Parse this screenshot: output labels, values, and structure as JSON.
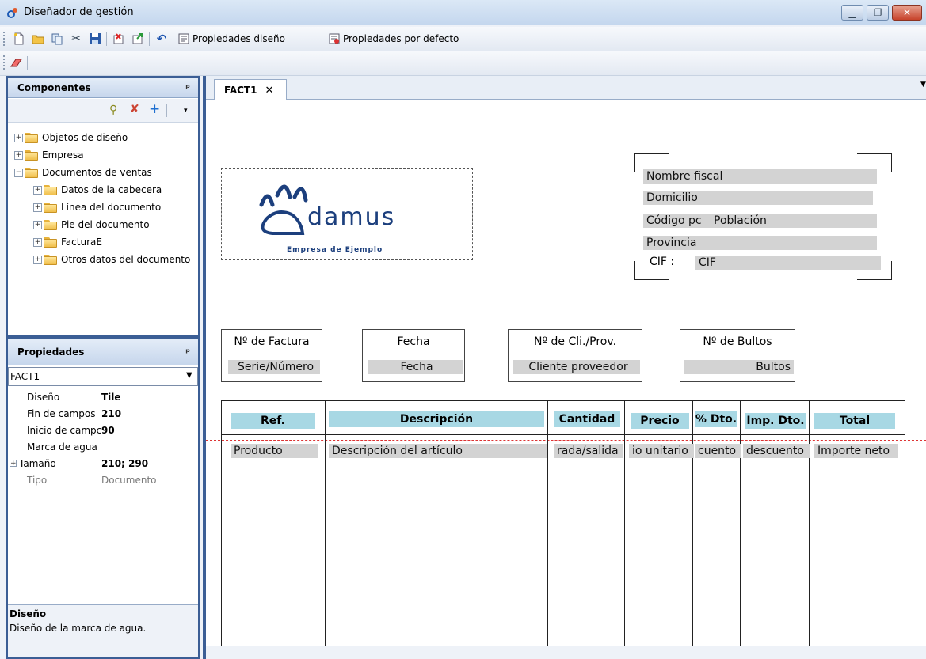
{
  "window": {
    "title": "Diseñador de gestión"
  },
  "toolbar": {
    "design_props": "Propiedades diseño",
    "default_props": "Propiedades por defecto"
  },
  "components": {
    "title": "Componentes",
    "tree": [
      {
        "label": "Objetos de diseño",
        "level": 0,
        "expander": "+"
      },
      {
        "label": "Empresa",
        "level": 0,
        "expander": "+"
      },
      {
        "label": "Documentos de ventas",
        "level": 0,
        "expander": "−"
      },
      {
        "label": "Datos de la cabecera",
        "level": 1,
        "expander": "+"
      },
      {
        "label": "Línea del documento",
        "level": 1,
        "expander": "+"
      },
      {
        "label": "Pie del documento",
        "level": 1,
        "expander": "+"
      },
      {
        "label": "FacturaE",
        "level": 1,
        "expander": "+"
      },
      {
        "label": "Otros datos del documento",
        "level": 1,
        "expander": "+"
      }
    ]
  },
  "properties": {
    "title": "Propiedades",
    "selected": "FACT1",
    "rows": [
      {
        "key": "Diseño",
        "value": "Tile"
      },
      {
        "key": "Fin de campos",
        "value": "210"
      },
      {
        "key": "Inicio de campc",
        "value": "90"
      },
      {
        "key": "Marca de agua",
        "value": ""
      },
      {
        "key": "Tamaño",
        "value": "210; 290"
      },
      {
        "key": "Tipo",
        "value": "Documento"
      }
    ],
    "help_title": "Diseño",
    "help_text": "Diseño de la marca de agua."
  },
  "editor": {
    "tab": "FACT1",
    "logo_text": "damus",
    "logo_sub": "Empresa de Ejemplo",
    "address": {
      "nombre": "Nombre fiscal",
      "domicilio": "Domicilio",
      "cp": "Código pc",
      "poblacion": "Población",
      "provincia": "Provincia",
      "cif_label": "CIF :",
      "cif": "CIF"
    },
    "info": {
      "factura_label": "Nº de Factura",
      "factura_value": "Serie/Número",
      "fecha_label": "Fecha",
      "fecha_value": "Fecha",
      "cliente_label": "Nº de Cli./Prov.",
      "cliente_value": "Cliente proveedor",
      "bultos_label": "Nº de Bultos",
      "bultos_value": "Bultos"
    },
    "columns": [
      "Ref.",
      "Descripción",
      "Cantidad",
      "Precio",
      "% Dto.",
      "Imp. Dto.",
      "Total"
    ],
    "line": [
      "Producto",
      "Descripción del artículo",
      "rada/salida",
      "io unitario",
      "cuento",
      "descuento",
      "Importe neto"
    ]
  }
}
